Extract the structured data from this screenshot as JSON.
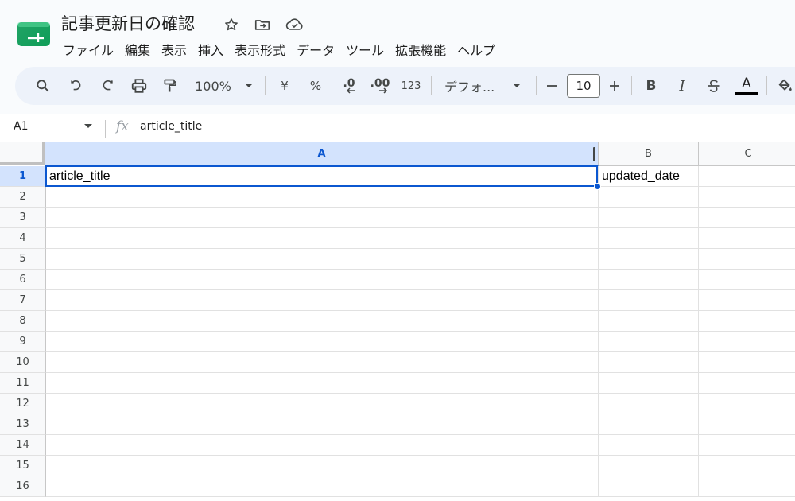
{
  "doc": {
    "title": "記事更新日の確認"
  },
  "menu": [
    "ファイル",
    "編集",
    "表示",
    "挿入",
    "表示形式",
    "データ",
    "ツール",
    "拡張機能",
    "ヘルプ"
  ],
  "toolbar": {
    "zoom": "100%",
    "currency": "¥",
    "percent": "%",
    "decrease_decimal": ".0",
    "increase_decimal": ".00",
    "number_format": "123",
    "font": "デフォ...",
    "font_size": "10",
    "bold": "B",
    "italic": "I",
    "text_color": "A"
  },
  "formula_bar": {
    "cell_ref": "A1",
    "fx": "fx",
    "content": "article_title"
  },
  "columns": [
    "A",
    "B",
    "C"
  ],
  "rows": [
    "1",
    "2",
    "3",
    "4",
    "5",
    "6",
    "7",
    "8",
    "9",
    "10",
    "11",
    "12",
    "13",
    "14",
    "15",
    "16"
  ],
  "cells": {
    "A1": "article_title",
    "B1": "updated_date"
  },
  "colors": {
    "accent": "#0b57d0",
    "selected_header": "#d3e3fd",
    "toolbar_bg": "#edf2fa",
    "logo_green": "#0f9d58"
  }
}
